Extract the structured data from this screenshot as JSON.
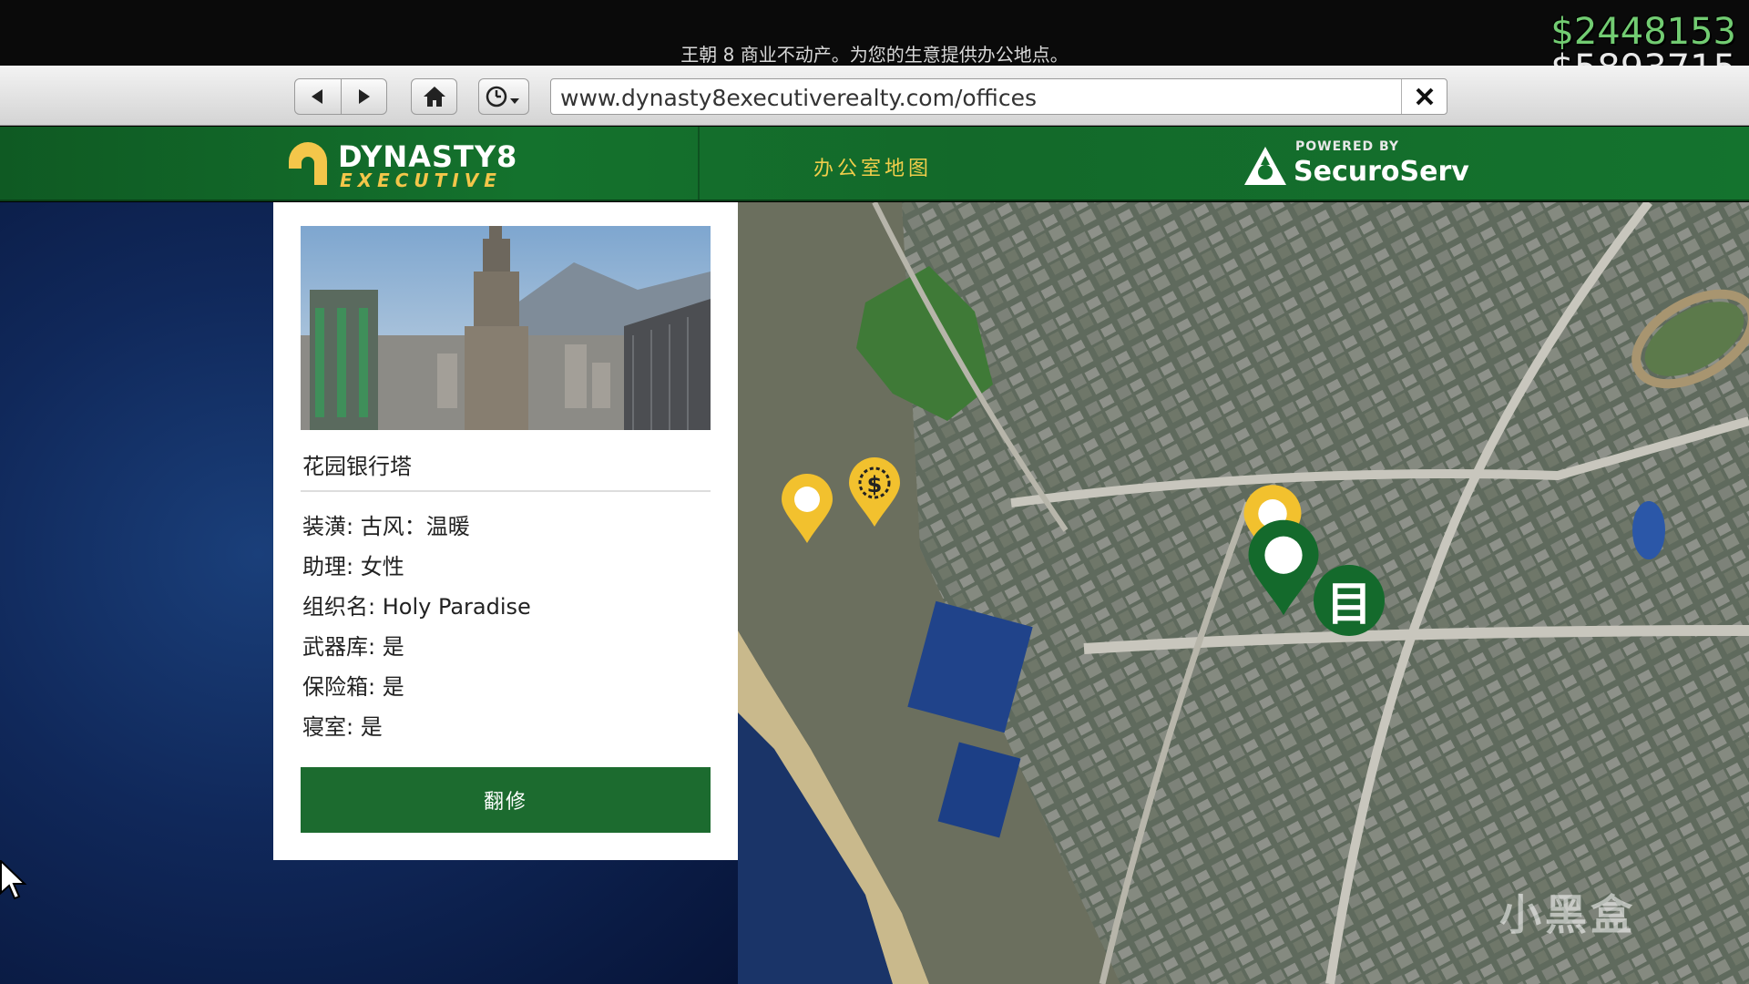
{
  "hud": {
    "tagline": "王朝 8 商业不动产。为您的生意提供办公地点。",
    "money_wallet": "$2448153",
    "money_bank": "$5893715"
  },
  "browser": {
    "url": "www.dynasty8executiverealty.com/offices"
  },
  "header": {
    "logo_main": "DYNASTY8",
    "logo_sub": "EXECUTIVE",
    "tab_map": "办公室地图",
    "powered_by": "POWERED BY",
    "powered_name": "SecuroServ"
  },
  "property": {
    "title": "花园银行塔",
    "details": [
      {
        "label": "装潢: ",
        "value": "古风：温暖"
      },
      {
        "label": "助理: ",
        "value": "女性"
      },
      {
        "label": "组织名: ",
        "value": "Holy Paradise"
      },
      {
        "label": "武器库: ",
        "value": "是"
      },
      {
        "label": "保险箱: ",
        "value": "是"
      },
      {
        "label": "寝室: ",
        "value": "是"
      }
    ],
    "button_label": "翻修"
  },
  "map_markers": [
    {
      "type": "office-pin",
      "color": "#f2c12e"
    },
    {
      "type": "dollar-pin",
      "color": "#f2c12e",
      "glyph": "$"
    },
    {
      "type": "office-pin",
      "color": "#f2c12e"
    },
    {
      "type": "selected-pin",
      "color": "#146a2c"
    },
    {
      "type": "owned-office-marker",
      "color": "#146a2c",
      "glyph": "目"
    }
  ],
  "watermark": "小黑盒",
  "colors": {
    "brand_green": "#14722d",
    "accent_gold": "#f0cd4a",
    "button_green": "#1c6b2f"
  }
}
